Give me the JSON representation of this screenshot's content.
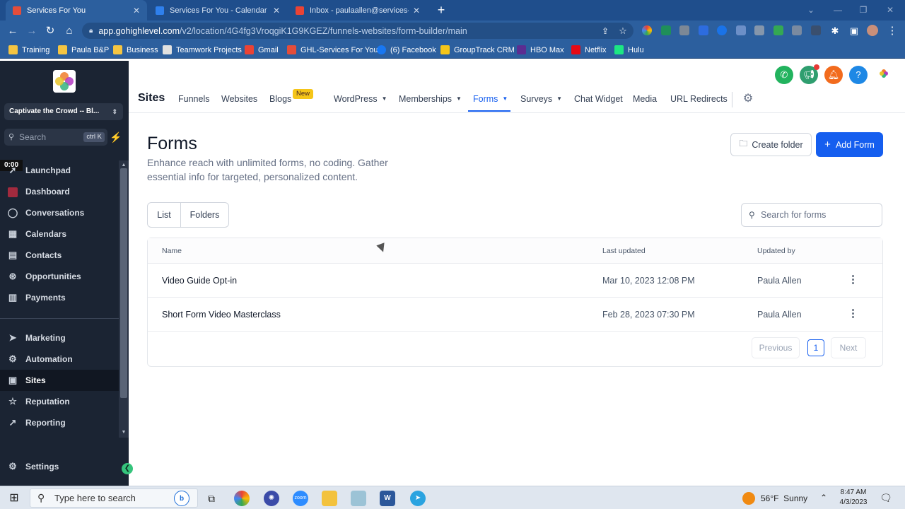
{
  "browser": {
    "tabs": [
      {
        "title": "Services For You",
        "active": true,
        "favicon_color": "#e44d3a"
      },
      {
        "title": "Services For You - Calendar - We",
        "active": false,
        "favicon_color": "#2f80ed"
      },
      {
        "title": "Inbox - paulaallen@services-fory",
        "active": false,
        "favicon_color": "#ea4335"
      }
    ],
    "new_tab": "+",
    "url_host": "app.gohighlevel.com",
    "url_path": "/v2/location/4G4fg3VroqgiK1G9KGEZ/funnels-websites/form-builder/main",
    "bookmarks": [
      {
        "label": "Training",
        "color": "#f5c542"
      },
      {
        "label": "Paula B&P",
        "color": "#f5c542"
      },
      {
        "label": "Business",
        "color": "#f5c542"
      },
      {
        "label": "Teamwork Projects",
        "color": "#e0e0e0"
      },
      {
        "label": "Gmail",
        "color": "#ea4335"
      },
      {
        "label": "GHL-Services For You",
        "color": "#e44d3a"
      },
      {
        "label": "(6) Facebook",
        "color": "#1877f2"
      },
      {
        "label": "GroupTrack CRM",
        "color": "#f5c518"
      },
      {
        "label": "HBO Max",
        "color": "#5c2d91"
      },
      {
        "label": "Netflix",
        "color": "#e50914"
      },
      {
        "label": "Hulu",
        "color": "#1ce783"
      }
    ]
  },
  "sidebar": {
    "account": "Captivate the Crowd -- Bl...",
    "search_placeholder": "Search",
    "search_shortcut": "ctrl K",
    "timer": "0:00",
    "items": [
      {
        "label": "Launchpad",
        "icon": "rocket-icon"
      },
      {
        "label": "Dashboard",
        "icon": "dashboard-icon"
      },
      {
        "label": "Conversations",
        "icon": "chat-icon"
      },
      {
        "label": "Calendars",
        "icon": "calendar-icon"
      },
      {
        "label": "Contacts",
        "icon": "contacts-icon"
      },
      {
        "label": "Opportunities",
        "icon": "opportunities-icon"
      },
      {
        "label": "Payments",
        "icon": "payments-icon"
      },
      {
        "label": "Marketing",
        "icon": "send-icon"
      },
      {
        "label": "Automation",
        "icon": "automation-icon"
      },
      {
        "label": "Sites",
        "icon": "sites-icon",
        "active": true
      },
      {
        "label": "Reputation",
        "icon": "star-icon"
      },
      {
        "label": "Reporting",
        "icon": "chart-icon"
      }
    ],
    "settings_label": "Settings"
  },
  "topnav": {
    "title": "Sites",
    "items": [
      "Funnels",
      "Websites",
      "Blogs",
      "WordPress",
      "Memberships",
      "Forms",
      "Surveys",
      "Chat Widget",
      "Media",
      "URL Redirects"
    ],
    "new_badge": "New",
    "active": "Forms",
    "action_icons": [
      {
        "name": "phone-icon",
        "color": "#22b35e"
      },
      {
        "name": "megaphone-icon",
        "color": "#2f9e6f"
      },
      {
        "name": "bell-icon",
        "color": "#f26b1d"
      },
      {
        "name": "help-icon",
        "color": "#1e88e5"
      }
    ]
  },
  "page": {
    "title": "Forms",
    "subtitle": "Enhance reach with unlimited forms, no coding. Gather essential info for targeted, personalized content.",
    "create_folder": "Create folder",
    "add_form": "Add Form",
    "view_list": "List",
    "view_folders": "Folders",
    "search_placeholder": "Search for forms"
  },
  "table": {
    "columns": [
      "Name",
      "Last updated",
      "Updated by"
    ],
    "rows": [
      {
        "name": "Video Guide Opt-in",
        "updated": "Mar 10, 2023 12:08 PM",
        "by": "Paula Allen"
      },
      {
        "name": "Short Form Video Masterclass",
        "updated": "Feb 28, 2023 07:30 PM",
        "by": "Paula Allen"
      }
    ],
    "pagination": {
      "previous": "Previous",
      "page": "1",
      "next": "Next"
    }
  },
  "taskbar": {
    "search_placeholder": "Type here to search",
    "weather": "56°F  Sunny",
    "time": "8:47 AM",
    "date": "4/3/2023"
  }
}
